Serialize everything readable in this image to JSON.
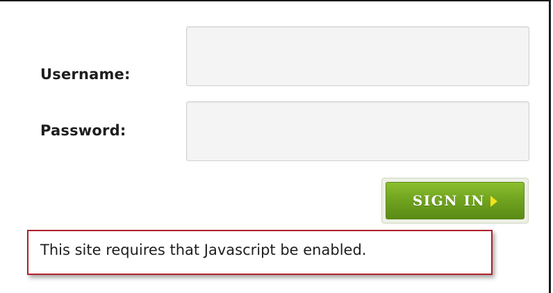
{
  "form": {
    "username_label": "Username:",
    "password_label": "Password:",
    "username_value": "",
    "password_value": "",
    "signin_label": "SIGN IN",
    "signin_icon": "arrow-right-icon",
    "button_color": "#6fa21f",
    "arrow_color": "#f3e21b"
  },
  "notice": {
    "message": "This site requires that Javascript be enabled.",
    "border_color": "#b0202a"
  }
}
